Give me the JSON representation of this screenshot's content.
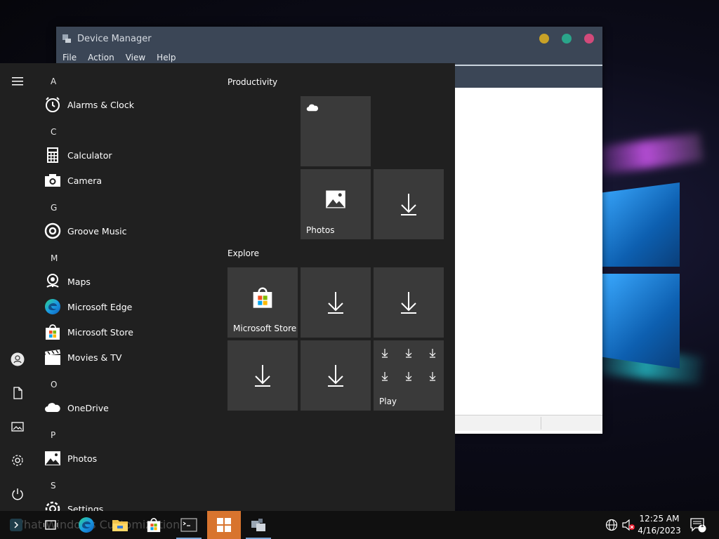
{
  "device_manager": {
    "title": "Device Manager",
    "menu": [
      "File",
      "Action",
      "View",
      "Help"
    ],
    "window_dots": [
      "#c9a227",
      "#2aa58a",
      "#d24a7a"
    ]
  },
  "start_menu": {
    "app_list": [
      {
        "type": "letter",
        "text": "A"
      },
      {
        "type": "app",
        "label": "Alarms & Clock",
        "icon": "alarm-clock-icon"
      },
      {
        "type": "letter",
        "text": "C"
      },
      {
        "type": "app",
        "label": "Calculator",
        "icon": "calculator-icon"
      },
      {
        "type": "app",
        "label": "Camera",
        "icon": "camera-icon"
      },
      {
        "type": "letter",
        "text": "G"
      },
      {
        "type": "app",
        "label": "Groove Music",
        "icon": "groove-music-icon"
      },
      {
        "type": "letter",
        "text": "M"
      },
      {
        "type": "app",
        "label": "Maps",
        "icon": "maps-icon"
      },
      {
        "type": "app",
        "label": "Microsoft Edge",
        "icon": "edge-icon"
      },
      {
        "type": "app",
        "label": "Microsoft Store",
        "icon": "store-icon"
      },
      {
        "type": "app",
        "label": "Movies & TV",
        "icon": "movies-icon"
      },
      {
        "type": "letter",
        "text": "O"
      },
      {
        "type": "app",
        "label": "OneDrive",
        "icon": "onedrive-icon"
      },
      {
        "type": "letter",
        "text": "P"
      },
      {
        "type": "app",
        "label": "Photos",
        "icon": "photos-icon"
      },
      {
        "type": "letter",
        "text": "S"
      },
      {
        "type": "app",
        "label": "Settings",
        "icon": "settings-icon"
      }
    ],
    "groups": {
      "productivity": "Productivity",
      "explore": "Explore"
    },
    "tiles": {
      "photos": "Photos",
      "microsoft_store": "Microsoft Store",
      "play": "Play"
    }
  },
  "taskbar": {
    "search_text": "What Windows Customization?",
    "clock_time": "12:25 AM",
    "clock_date": "4/16/2023",
    "notification_count": "1"
  }
}
